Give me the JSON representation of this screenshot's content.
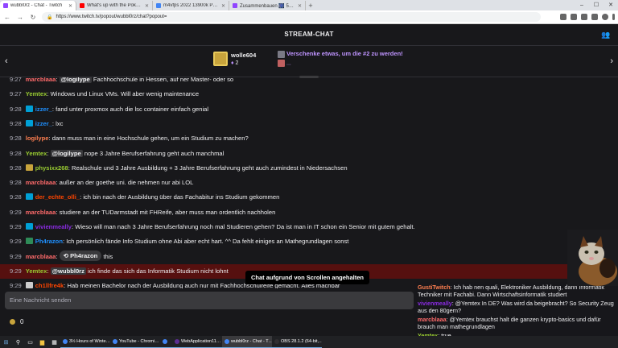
{
  "browser": {
    "tabs": [
      {
        "title": "wubbl0rz - Chat - Twitch",
        "color": "#9146ff",
        "active": true
      },
      {
        "title": "What's up with the Pokémon BDSP…",
        "color": "#ff0000",
        "active": false
      },
      {
        "title": "m4vfps 2022 13900k Preisvergleich…",
        "color": "#4285f4",
        "active": false
      },
      {
        "title": "Zusammenbauen 🎆 500€ …",
        "color": "#9146ff",
        "active": false
      }
    ],
    "new_tab": "+",
    "url": "https://www.twitch.tv/popout/wubbl0rz/chat?popout=",
    "back": "←",
    "forward": "→",
    "reload": "↻",
    "min": "–",
    "max": "☐",
    "close": "✕"
  },
  "chat": {
    "title": "STREAM-CHAT",
    "users_icon": "👥"
  },
  "gift": {
    "name": "wolle604",
    "count": "2",
    "cta": "Verschenke etwas, um die #2 zu werden!",
    "more": "..."
  },
  "messages": [
    {
      "time": "9:27",
      "user": "marcblaaa",
      "color": "#ff6b6b",
      "badge": "",
      "mention": "@logilype",
      "text": " Fachhochschule in Hessen, auf ner Master- oder so"
    },
    {
      "time": "9:27",
      "user": "Yemtex",
      "color": "#9acd32",
      "badge": "",
      "mention": "",
      "text": "Windows und Linux VMs. Will aber wenig maintenance"
    },
    {
      "time": "9:28",
      "user": "izzer_",
      "color": "#1e90ff",
      "badge": "#00a0d6",
      "mention": "",
      "text": "fand unter proxmox auch die lsc container einfach genial"
    },
    {
      "time": "9:28",
      "user": "izzer_",
      "color": "#1e90ff",
      "badge": "#00a0d6",
      "mention": "",
      "text": "lxc"
    },
    {
      "time": "9:28",
      "user": "logilype",
      "color": "#ff7f50",
      "badge": "",
      "mention": "",
      "text": "dann muss man in eine Hochschule gehen, um ein Studium zu machen?"
    },
    {
      "time": "9:28",
      "user": "Yemtex",
      "color": "#9acd32",
      "badge": "",
      "mention": "@logilype",
      "text": " nope 3 Jahre Berufserfahrung geht auch manchmal"
    },
    {
      "time": "9:28",
      "user": "physixx268",
      "color": "#9acd32",
      "badge": "#c8a43c",
      "mention": "",
      "text": "Realschule und 3 Jahre Ausbildung + 3 Jahre Berufserfahrung geht auch zumindest in Niedersachsen"
    },
    {
      "time": "9:28",
      "user": "marcblaaa",
      "color": "#ff6b6b",
      "badge": "",
      "mention": "",
      "text": "außer an der goethe uni. die nehmen nur abi LOL"
    },
    {
      "time": "9:28",
      "user": "der_echte_olli_",
      "color": "#ff4500",
      "badge": "#00a0d6",
      "mention": "",
      "text": "ich bin nach der Ausbildung über das Fachabitur ins Studium gekommen"
    },
    {
      "time": "9:29",
      "user": "marcblaaa",
      "color": "#ff6b6b",
      "badge": "",
      "mention": "",
      "text": "studiere an der TUDarmstadt mit FHReife, aber muss man ordentlich nachholen"
    },
    {
      "time": "9:29",
      "user": "vivienmeally",
      "color": "#8a2be2",
      "badge": "#00a0d6",
      "mention": "",
      "text": "Wieso will man nach 3 Jahre Berufserfahrung noch mal Studieren gehen? Da ist man in IT schon ein Senior mit gutem gehalt."
    },
    {
      "time": "9:29",
      "user": "Ph4razon",
      "color": "#1e90ff",
      "badge": "#2e8b57",
      "mention": "",
      "text": "Ich persönlich fände Info Studium ohne Abi aber echt hart. ^^ Da fehlt einiges an Mathegrundlagen sonst"
    },
    {
      "time": "9:29",
      "user": "marcblaaa",
      "color": "#ff6b6b",
      "badge": "",
      "mention": "",
      "text": "this"
    },
    {
      "time": "9:29",
      "user": "Yemtex",
      "color": "#9acd32",
      "badge": "",
      "mention": "@wubbl0rz",
      "text": " ich finde das sich das Informatik Studium nicht lohnt"
    },
    {
      "time": "9:29",
      "user": "ch1llfre4k",
      "color": "#ff4500",
      "badge": "#cccccc",
      "mention": "",
      "text": "Hab meinen Bachelor nach der Ausbildung auch nur mit Fachhochschulreife gemacht. Alles machbar"
    }
  ],
  "reply_pill": "Ph4razon",
  "paused_notice": "Chat aufgrund von Scrollen angehalten",
  "input": {
    "placeholder": "Eine Nachricht senden"
  },
  "channel_points": "0",
  "overlay_messages": [
    {
      "user": "GustiTwitch",
      "color": "#ff7f50",
      "text": "Ich hab nen quali, Elektroniker Ausbildung, dann Informatik Techniker mit Fachabi. Dann Wirtschaftsinformatik studiert"
    },
    {
      "user": "vivienmeally",
      "color": "#8a2be2",
      "text": "@Yemtex In DE? Was wird da beigebracht? So Security Zeug aus den 80gern?"
    },
    {
      "user": "marcblaaa",
      "color": "#ff6b6b",
      "text": "@Yemtex brauchst halt die ganzen krypto-basics und dafür brauch man mathegrundlagen"
    },
    {
      "user": "Yemtex",
      "color": "#9acd32",
      "text": "true"
    }
  ],
  "taskbar": {
    "apps": [
      {
        "title": "3½ Hours of Winte…",
        "color": "#4285f4"
      },
      {
        "title": "YouTube - Chromi…",
        "color": "#4285f4"
      },
      {
        "title": "",
        "color": "#4285f4"
      },
      {
        "title": "WebApplication11…",
        "color": "#5c2d91"
      },
      {
        "title": "wubbl0rz - Chat - T…",
        "color": "#4285f4"
      },
      {
        "title": "OBS 28.1.2 (64-bit,…",
        "color": "#302e31"
      }
    ]
  }
}
